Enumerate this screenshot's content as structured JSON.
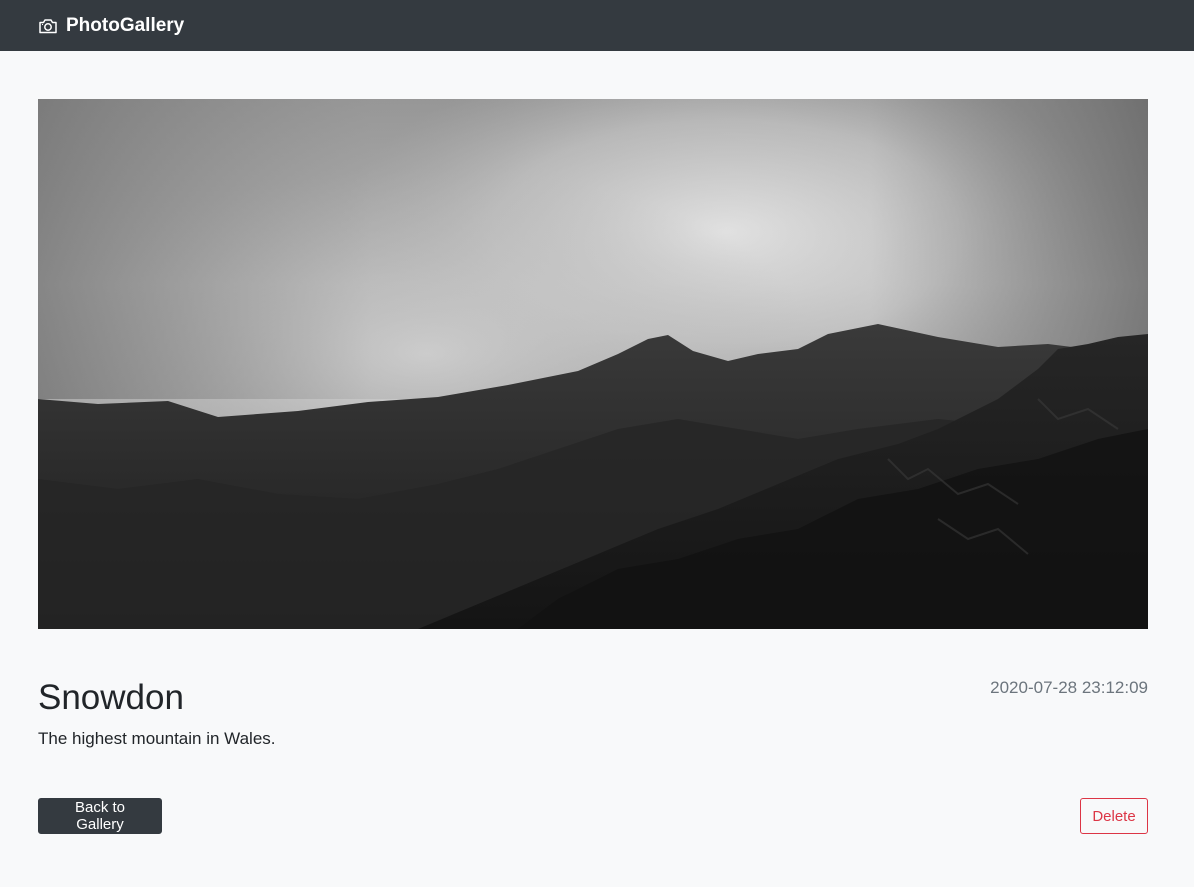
{
  "navbar": {
    "brand_label": "PhotoGallery",
    "brand_icon": "camera-icon"
  },
  "photo": {
    "title": "Snowdon",
    "description": "The highest mountain in Wales.",
    "timestamp": "2020-07-28 23:12:09"
  },
  "actions": {
    "back_label": "Back to Gallery",
    "delete_label": "Delete"
  },
  "colors": {
    "navbar_bg": "#343a40",
    "page_bg": "#f8f9fa",
    "danger": "#dc3545",
    "muted": "#6c757d"
  }
}
